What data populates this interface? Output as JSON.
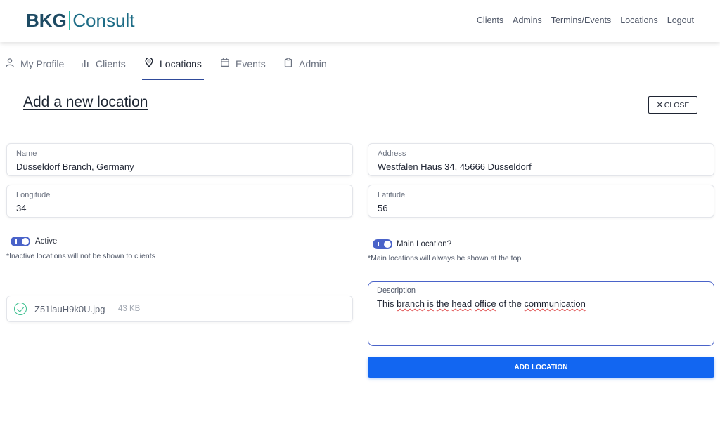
{
  "header": {
    "logo_left": "BKG",
    "logo_right": "Consult",
    "nav": [
      "Clients",
      "Admins",
      "Termins/Events",
      "Locations",
      "Logout"
    ]
  },
  "tabs": [
    {
      "label": "My Profile",
      "icon": "user-icon"
    },
    {
      "label": "Clients",
      "icon": "bar-chart-icon"
    },
    {
      "label": "Locations",
      "icon": "location-pin-icon",
      "active": true
    },
    {
      "label": "Events",
      "icon": "calendar-icon"
    },
    {
      "label": "Admin",
      "icon": "clipboard-icon"
    }
  ],
  "page": {
    "title": "Add a new location",
    "close_label": "CLOSE"
  },
  "form": {
    "name": {
      "label": "Name",
      "value": "Düsseldorf Branch, Germany"
    },
    "address": {
      "label": "Address",
      "value": "Westfalen Haus 34, 45666 Düsseldorf"
    },
    "longitude": {
      "label": "Longitude",
      "value": "34"
    },
    "latitude": {
      "label": "Latitude",
      "value": "56"
    },
    "active": {
      "label": "Active",
      "checked": true,
      "hint": "*Inactive locations will not be shown to clients"
    },
    "main_location": {
      "label": "Main Location?",
      "checked": true,
      "hint": "*Main locations will always be shown at the top"
    },
    "file": {
      "name": "Z51lauH9k0U.jpg",
      "size": "43 KB"
    },
    "description": {
      "label": "Description",
      "value_parts": [
        "This ",
        "branch",
        " ",
        "is",
        " ",
        "the",
        " ",
        "head",
        " ",
        "office",
        " of the ",
        "communication"
      ]
    },
    "submit_label": "ADD LOCATION"
  },
  "colors": {
    "accent": "#1266f1",
    "toggle": "#4a63c9",
    "logo_dark": "#1d4a63",
    "logo_teal": "#2bb6a8",
    "success": "#3bbf8e"
  }
}
